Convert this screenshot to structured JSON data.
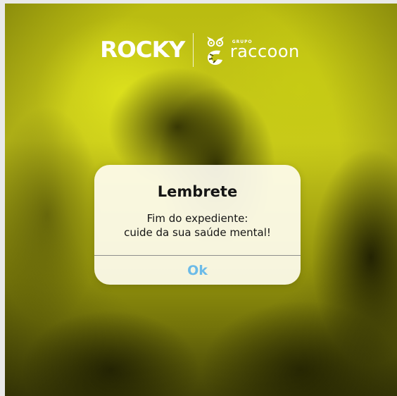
{
  "brand": {
    "primary_logo": "ROCKY",
    "group_label": "GRUPO",
    "group_logo": "raccoon",
    "group_icon": "raccoon-icon"
  },
  "dialog": {
    "title": "Lembrete",
    "message_line1": "Fim do expediente:",
    "message_line2": "cuide da sua saúde mental!",
    "ok_label": "Ok"
  },
  "colors": {
    "background_tint": "#c8c91a",
    "dialog_bg": "#fffdf0",
    "ok_text": "#6cbbe8",
    "logo": "#ffffff"
  }
}
